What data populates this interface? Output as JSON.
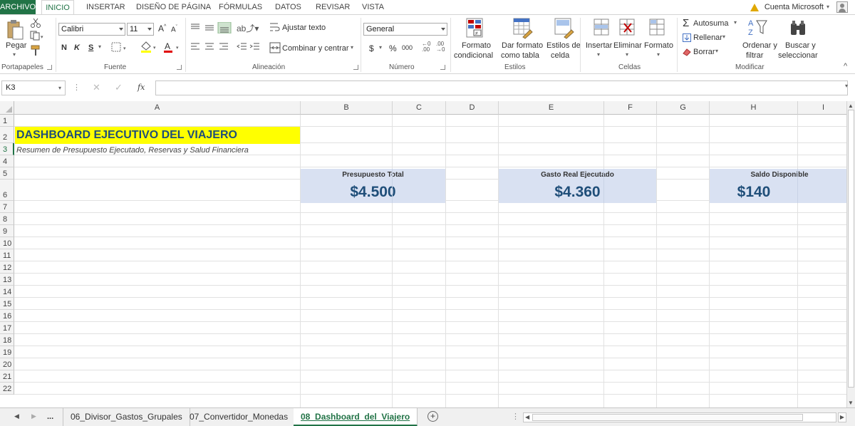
{
  "menu": {
    "file": "ARCHIVO",
    "tabs": [
      "INICIO",
      "INSERTAR",
      "DISEÑO DE PÁGINA",
      "FÓRMULAS",
      "DATOS",
      "REVISAR",
      "VISTA"
    ],
    "account": "Cuenta Microsoft"
  },
  "ribbon": {
    "paste": "Pegar",
    "font_name": "Calibri",
    "font_size": "11",
    "bold": "N",
    "italic": "K",
    "underline": "S",
    "wrap": "Ajustar texto",
    "merge": "Combinar y centrar",
    "number_format": "General",
    "currency": "$",
    "percent": "%",
    "thousands": "000",
    "cond_format_1": "Formato",
    "cond_format_2": "condicional",
    "table_format_1": "Dar formato",
    "table_format_2": "como tabla",
    "cell_styles_1": "Estilos de",
    "cell_styles_2": "celda",
    "insert": "Insertar",
    "delete": "Eliminar",
    "format": "Formato",
    "autosum": "Autosuma",
    "fill": "Rellenar",
    "clear": "Borrar",
    "sort_1": "Ordenar y",
    "sort_2": "filtrar",
    "find_1": "Buscar y",
    "find_2": "seleccionar",
    "groups": {
      "clipboard": "Portapapeles",
      "font": "Fuente",
      "alignment": "Alineación",
      "number": "Número",
      "styles": "Estilos",
      "cells": "Celdas",
      "editing": "Modificar"
    }
  },
  "formula_bar": {
    "name_box": "K3",
    "fx": "fx",
    "value": ""
  },
  "grid": {
    "columns": [
      "A",
      "B",
      "C",
      "D",
      "E",
      "F",
      "G",
      "H",
      "I"
    ],
    "rows": [
      "1",
      "2",
      "3",
      "4",
      "5",
      "6",
      "7",
      "8",
      "9",
      "10",
      "11",
      "12",
      "13",
      "14",
      "15",
      "16",
      "17",
      "18",
      "19",
      "20",
      "21",
      "22"
    ],
    "active_row": "3",
    "title": "DASHBOARD EJECUTIVO DEL VIAJERO",
    "subtitle": "Resumen de Presupuesto Ejecutado, Reservas y Salud Financiera",
    "kpis": [
      {
        "label": "Presupuesto Total",
        "value": "$4.500"
      },
      {
        "label": "Gasto Real Ejecutado",
        "value": "$4.360"
      },
      {
        "label": "Saldo Disponible",
        "value": "$140"
      }
    ],
    "colors": {
      "title_fill": "#ffff00",
      "title_text": "#1f4e79",
      "kpi_fill": "#d9e1f2",
      "kpi_value": "#1f4e79",
      "accent": "#217346"
    }
  },
  "sheets": {
    "ellipsis": "...",
    "tabs": [
      "06_Divisor_Gastos_Grupales",
      "07_Convertidor_Monedas",
      "08_Dashboard_del_Viajero"
    ],
    "active": "08_Dashboard_del_Viajero"
  }
}
